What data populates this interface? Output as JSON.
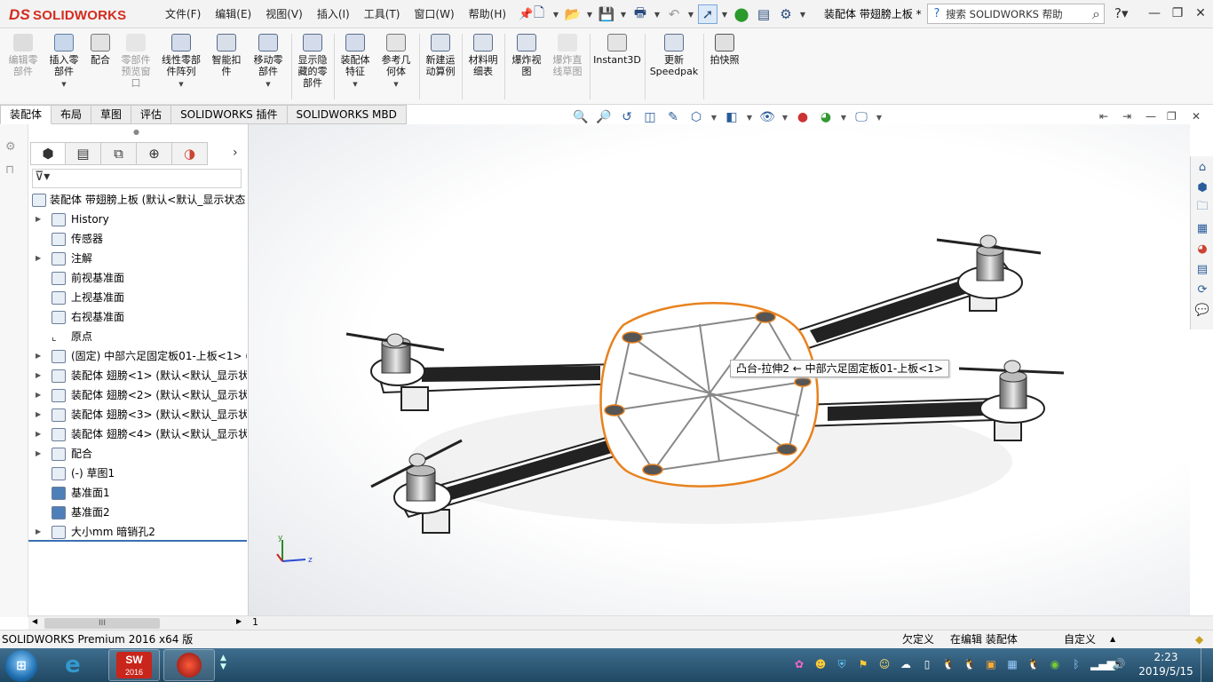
{
  "app": {
    "logo": "SOLIDWORKS",
    "logo_prefix": "DS"
  },
  "menu": [
    "文件(F)",
    "编辑(E)",
    "视图(V)",
    "插入(I)",
    "工具(T)",
    "窗口(W)",
    "帮助(H)"
  ],
  "document_title": "装配体 带翅膀上板 *",
  "search": {
    "placeholder": "搜索 SOLIDWORKS 帮助"
  },
  "ribbon": [
    {
      "label": "编辑零\n部件",
      "disabled": true
    },
    {
      "label": "插入零\n部件",
      "disabled": false
    },
    {
      "label": "配合",
      "disabled": false
    },
    {
      "label": "零部件\n预览窗\n口",
      "disabled": true
    },
    {
      "label": "线性零部\n件阵列",
      "disabled": false
    },
    {
      "label": "智能扣\n件",
      "disabled": false
    },
    {
      "label": "移动零\n部件",
      "disabled": false
    },
    {
      "label": "显示隐\n藏的零\n部件",
      "disabled": false
    },
    {
      "label": "装配体\n特征",
      "disabled": false
    },
    {
      "label": "参考几\n何体",
      "disabled": false
    },
    {
      "label": "新建运\n动算例",
      "disabled": false
    },
    {
      "label": "材料明\n细表",
      "disabled": false
    },
    {
      "label": "爆炸视\n图",
      "disabled": false
    },
    {
      "label": "爆炸直\n线草图",
      "disabled": true
    },
    {
      "label": "Instant3D",
      "disabled": false
    },
    {
      "label": "更新\nSpeedpak",
      "disabled": false
    },
    {
      "label": "拍快照",
      "disabled": false
    }
  ],
  "command_tabs": [
    "装配体",
    "布局",
    "草图",
    "评估",
    "SOLIDWORKS 插件",
    "SOLIDWORKS MBD"
  ],
  "active_command_tab": "装配体",
  "tree": [
    {
      "label": "装配体 带翅膀上板  (默认<默认_显示状态",
      "indent": 0,
      "expander": false
    },
    {
      "label": "History",
      "indent": 1,
      "expander": true
    },
    {
      "label": "传感器",
      "indent": 1,
      "expander": false
    },
    {
      "label": "注解",
      "indent": 1,
      "expander": true
    },
    {
      "label": "前视基准面",
      "indent": 1,
      "expander": false
    },
    {
      "label": "上视基准面",
      "indent": 1,
      "expander": false
    },
    {
      "label": "右视基准面",
      "indent": 1,
      "expander": false
    },
    {
      "label": "原点",
      "indent": 1,
      "expander": false
    },
    {
      "label": "(固定) 中部六足固定板01-上板<1> (",
      "indent": 1,
      "expander": true
    },
    {
      "label": "装配体 翅膀<1> (默认<默认_显示状",
      "indent": 1,
      "expander": true
    },
    {
      "label": "装配体 翅膀<2> (默认<默认_显示状",
      "indent": 1,
      "expander": true
    },
    {
      "label": "装配体 翅膀<3> (默认<默认_显示状",
      "indent": 1,
      "expander": true
    },
    {
      "label": "装配体 翅膀<4> (默认<默认_显示状",
      "indent": 1,
      "expander": true
    },
    {
      "label": "配合",
      "indent": 1,
      "expander": true
    },
    {
      "label": "(-) 草图1",
      "indent": 1,
      "expander": false
    },
    {
      "label": "基准面1",
      "indent": 1,
      "expander": false
    },
    {
      "label": "基准面2",
      "indent": 1,
      "expander": false
    },
    {
      "label": "大小mm 暗销孔2",
      "indent": 1,
      "expander": true
    }
  ],
  "tooltip": "凸台-拉伸2 ← 中部六足固定板01-上板<1>",
  "bottom_tab": "1",
  "hscroll_thumb": "III",
  "triad": {
    "x": "z",
    "y": "y"
  },
  "status": {
    "left": "SOLIDWORKS Premium 2016 x64 版",
    "underdefined": "欠定义",
    "editing": "在编辑 装配体",
    "units": "自定义"
  },
  "taskbar": {
    "sw_badge": "2016",
    "time": "2:23",
    "date": "2019/5/15"
  },
  "colors": {
    "accent": "#d52b1e",
    "selection": "#e8821e",
    "tree_line": "#3a6fb4"
  }
}
